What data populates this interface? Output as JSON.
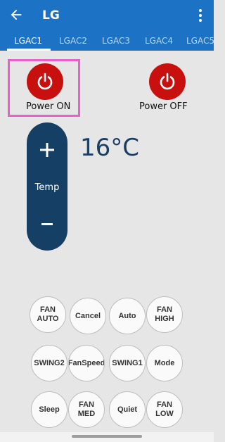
{
  "appbar": {
    "title": "LG",
    "back_icon": "arrow-back-icon",
    "menu_icon": "more-vert-icon",
    "color": "#1c72c4"
  },
  "tabs": [
    {
      "label": "LGAC1",
      "active": true
    },
    {
      "label": "LGAC2",
      "active": false
    },
    {
      "label": "LGAC3",
      "active": false
    },
    {
      "label": "LGAC4",
      "active": false
    },
    {
      "label": "LGAC5",
      "active": false
    }
  ],
  "power": {
    "on_label": "Power ON",
    "off_label": "Power OFF",
    "color": "#c8110f",
    "highlight_color": "#ec5fc8"
  },
  "temp": {
    "label": "Temp",
    "value": "16°C",
    "color": "#163f66"
  },
  "buttons": [
    "FAN AUTO",
    "Cancel",
    "Auto",
    "FAN HIGH",
    "SWING2",
    "FanSpeed",
    "SWING1",
    "Mode",
    "Sleep",
    "FAN MED",
    "Quiet",
    "FAN LOW"
  ]
}
